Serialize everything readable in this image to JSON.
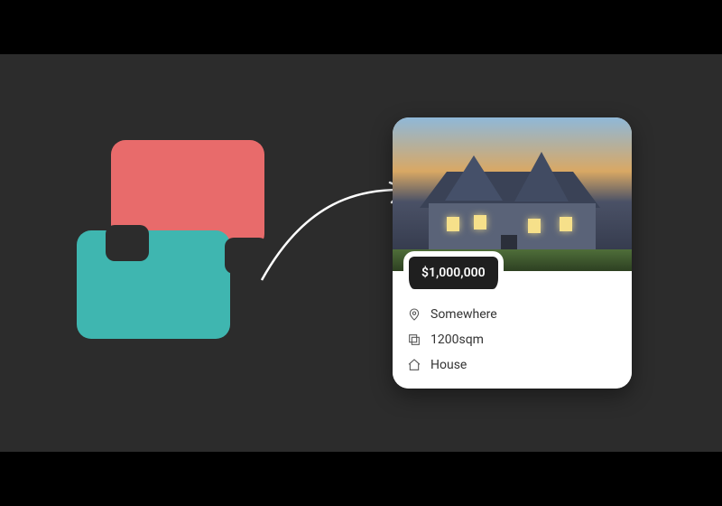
{
  "colors": {
    "stage_background": "#2c2c2c",
    "shape_top": "#e86b6b",
    "shape_bottom": "#3fb6b0",
    "price_chip_bg": "#1f1f1f",
    "price_chip_text": "#ffffff"
  },
  "property_card": {
    "price": "$1,000,000",
    "details": [
      {
        "icon": "map-pin-icon",
        "label": "Somewhere"
      },
      {
        "icon": "area-icon",
        "label": "1200sqm"
      },
      {
        "icon": "home-icon",
        "label": "House"
      }
    ]
  }
}
